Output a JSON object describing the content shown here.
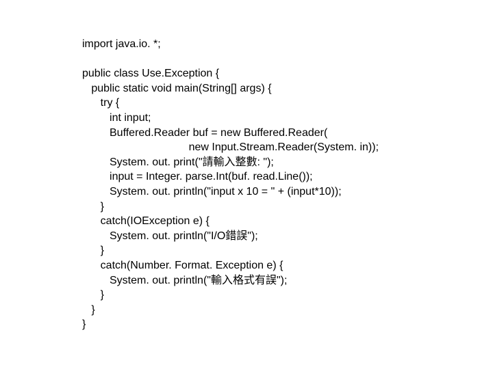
{
  "code": {
    "l01": "import java.io. *;",
    "l02": "",
    "l03": "public class Use.Exception {",
    "l04": "   public static void main(String[] args) {",
    "l05": "      try {",
    "l06": "         int input;",
    "l07": "         Buffered.Reader buf = new Buffered.Reader(",
    "l08": "                                   new Input.Stream.Reader(System. in));",
    "l09": "         System. out. print(\"請輸入整數: \");",
    "l10": "         input = Integer. parse.Int(buf. read.Line());",
    "l11": "         System. out. println(\"input x 10 = \" + (input*10));",
    "l12": "      }",
    "l13": "      catch(IOException e) {",
    "l14": "         System. out. println(\"I/O錯誤\");",
    "l15": "      }",
    "l16": "      catch(Number. Format. Exception e) {",
    "l17": "         System. out. println(\"輸入格式有誤\");",
    "l18": "      }",
    "l19": "   }",
    "l20": "}"
  }
}
